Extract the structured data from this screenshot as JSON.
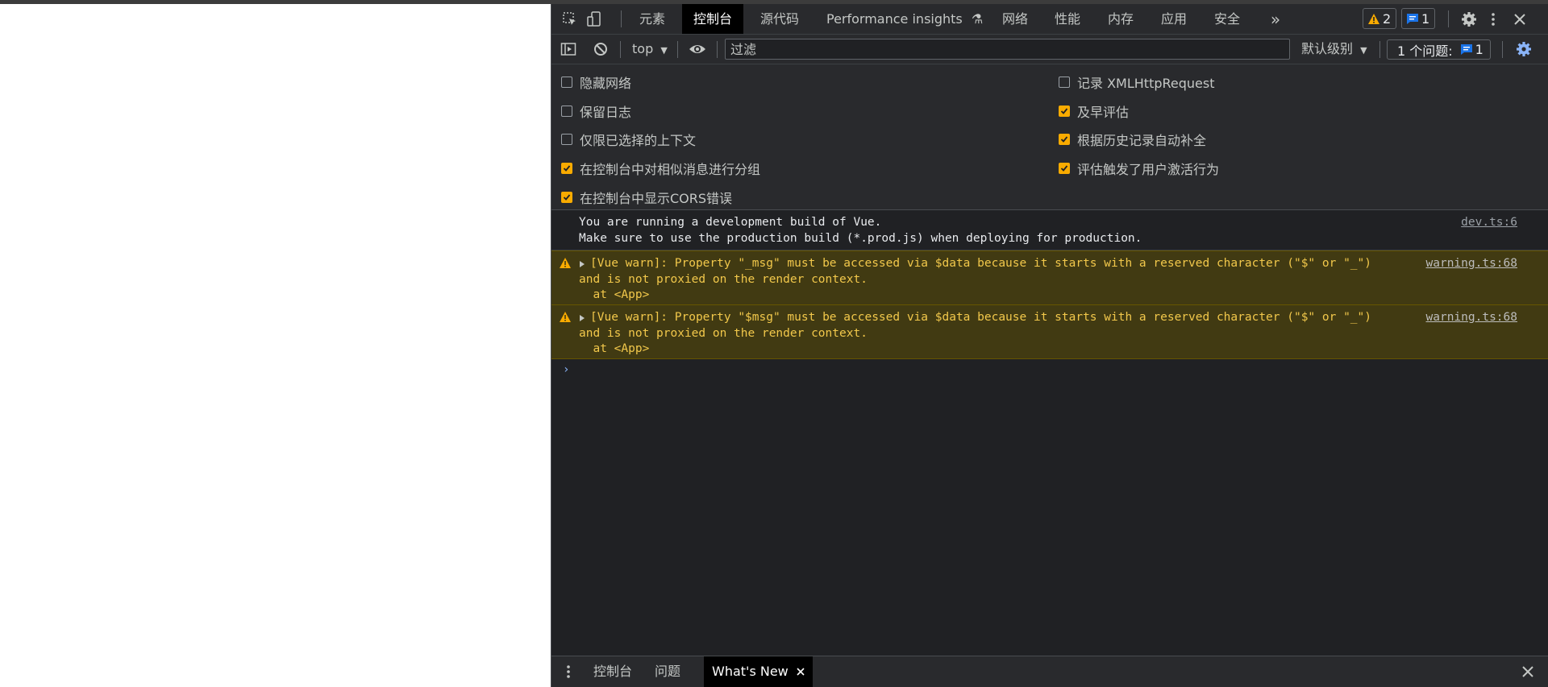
{
  "tabs": {
    "elements": "元素",
    "console": "控制台",
    "sources": "源代码",
    "performance_insights": "Performance insights",
    "network": "网络",
    "performance": "性能",
    "memory": "内存",
    "application": "应用",
    "security": "安全"
  },
  "badges": {
    "warnings": "2",
    "messages": "1"
  },
  "console_toolbar": {
    "context": "top",
    "filter_placeholder": "过滤",
    "levels": "默认级别",
    "issues_label": "1 个问题:",
    "issues_count": "1"
  },
  "settings": {
    "left": [
      {
        "label": "隐藏网络",
        "checked": false
      },
      {
        "label": "保留日志",
        "checked": false
      },
      {
        "label": "仅限已选择的上下文",
        "checked": false
      },
      {
        "label": "在控制台中对相似消息进行分组",
        "checked": true
      },
      {
        "label": "在控制台中显示CORS错误",
        "checked": true
      }
    ],
    "right": [
      {
        "label": "记录 XMLHttpRequest",
        "checked": false
      },
      {
        "label": "及早评估",
        "checked": true
      },
      {
        "label": "根据历史记录自动补全",
        "checked": true
      },
      {
        "label": "评估触发了用户激活行为",
        "checked": true
      }
    ]
  },
  "messages": [
    {
      "type": "info",
      "text": "You are running a development build of Vue.\nMake sure to use the production build (*.prod.js) when deploying for production.",
      "source": "dev.ts:6"
    },
    {
      "type": "warning",
      "text": "[Vue warn]: Property \"_msg\" must be accessed via $data because it starts with a reserved character (\"$\" or \"_\")\nand is not proxied on the render context.\n  at <App>",
      "source": "warning.ts:68"
    },
    {
      "type": "warning",
      "text": "[Vue warn]: Property \"$msg\" must be accessed via $data because it starts with a reserved character (\"$\" or \"_\")\nand is not proxied on the render context.\n  at <App>",
      "source": "warning.ts:68"
    }
  ],
  "drawer": {
    "console": "控制台",
    "issues": "问题",
    "whats_new": "What's New"
  },
  "colors": {
    "background": "#202124",
    "toolbar": "#292a2d",
    "warning_bg": "#413a12",
    "warning_text": "#f2c84b",
    "checkbox_on": "#f9ab00",
    "accent_blue": "#8ab4f8"
  }
}
